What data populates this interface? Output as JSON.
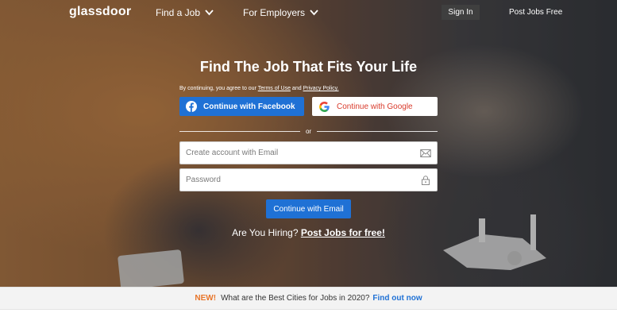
{
  "nav": {
    "logo": "glassdoor",
    "find_job": "Find a Job",
    "for_employers": "For Employers",
    "sign_in": "Sign In",
    "post_jobs": "Post Jobs Free"
  },
  "hero": {
    "headline": "Find The Job That Fits Your Life",
    "legal_prefix": "By continuing, you agree to our",
    "terms": "Terms of Use",
    "and": "and",
    "privacy": "Privacy Policy.",
    "facebook_label": "Continue with Facebook",
    "google_label": "Continue with Google",
    "or": "or",
    "email_placeholder": "Create account with Email",
    "password_placeholder": "Password",
    "email_button": "Continue with Email",
    "hiring_prefix": "Are You Hiring?",
    "hiring_link": "Post Jobs for free!"
  },
  "banner": {
    "new": "NEW!",
    "message": "What are the Best Cities for Jobs in 2020?",
    "link": "Find out now"
  },
  "colors": {
    "primary_blue": "#1f71d5",
    "google_red": "#d93b2c",
    "new_orange": "#e8762b"
  },
  "icons": {
    "facebook": "facebook-icon",
    "google": "google-icon",
    "email": "envelope-icon",
    "password": "lock-icon",
    "dropdown": "chevron-down-icon"
  }
}
